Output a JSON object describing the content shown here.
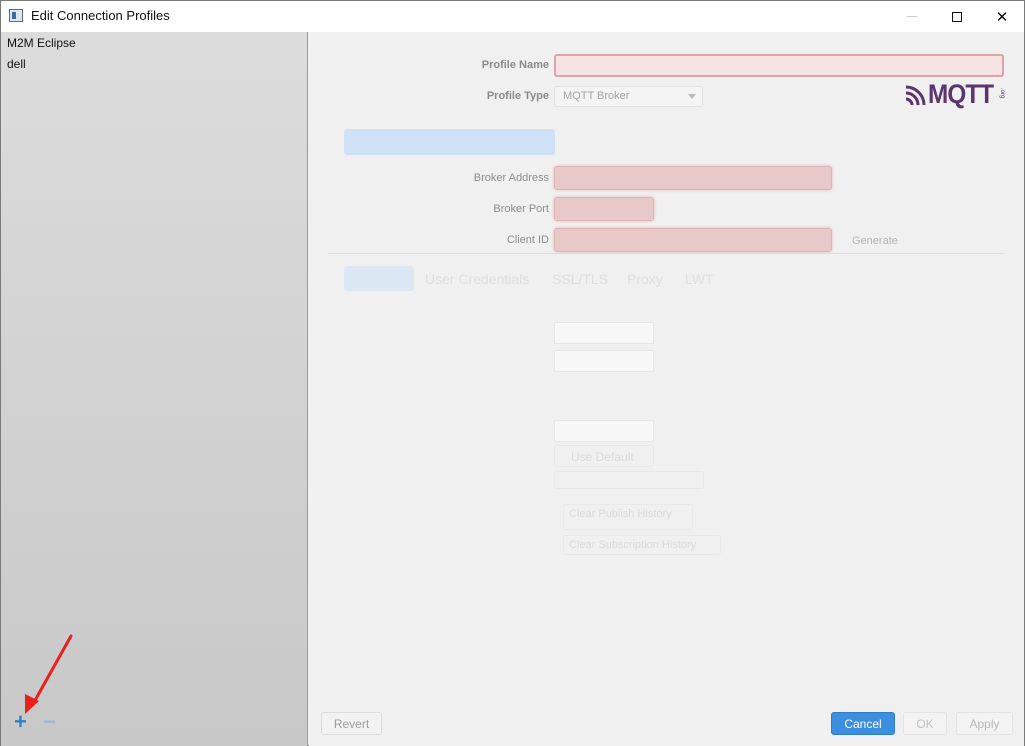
{
  "window": {
    "title": "Edit Connection Profiles",
    "controls": {
      "minimize": "minimize-icon",
      "maximize": "maximize-icon",
      "close": "close-icon"
    }
  },
  "sidebar": {
    "profiles": [
      {
        "label": "M2M Eclipse"
      },
      {
        "label": "dell"
      }
    ],
    "add_label": "+",
    "remove_label": "−"
  },
  "form": {
    "profile_name": {
      "label": "Profile Name",
      "value": ""
    },
    "profile_type": {
      "label": "Profile Type",
      "selected": "MQTT Broker"
    },
    "logo_text": "MQTT",
    "logo_org": ".org",
    "broker_address": {
      "label": "Broker Address",
      "value": ""
    },
    "broker_port": {
      "label": "Broker Port",
      "value": ""
    },
    "client_id": {
      "label": "Client ID",
      "value": ""
    },
    "generate_label": "Generate",
    "tabs": [
      "User Credentials",
      "SSL/TLS",
      "Proxy",
      "LWT"
    ],
    "use_default_label": "Use Default",
    "clear_publish_label": "Clear Publish History",
    "clear_subscription_label": "Clear Subscription History"
  },
  "footer": {
    "revert": "Revert",
    "cancel": "Cancel",
    "ok": "OK",
    "apply": "Apply"
  },
  "colors": {
    "accent": "#3c8fde",
    "invalid_field": "#e8c9c9",
    "annotation_arrow": "#e8211d"
  }
}
